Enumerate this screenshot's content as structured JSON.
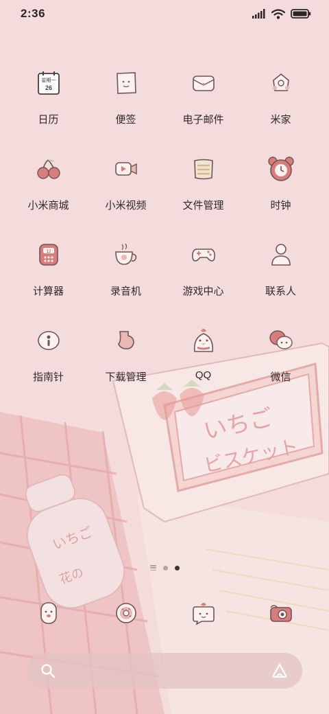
{
  "status_bar": {
    "time": "2:36"
  },
  "home_grid": [
    {
      "label": "日历",
      "icon": "calendar-icon",
      "calendar_weekday": "星期一",
      "calendar_day": "26"
    },
    {
      "label": "便签",
      "icon": "notes-icon"
    },
    {
      "label": "电子邮件",
      "icon": "email-icon"
    },
    {
      "label": "米家",
      "icon": "mijia-icon"
    },
    {
      "label": "小米商城",
      "icon": "cherry-icon"
    },
    {
      "label": "小米视频",
      "icon": "video-camera-icon"
    },
    {
      "label": "文件管理",
      "icon": "folder-icon"
    },
    {
      "label": "时钟",
      "icon": "bear-clock-icon"
    },
    {
      "label": "计算器",
      "icon": "calculator-icon",
      "calculator_display": "12"
    },
    {
      "label": "录音机",
      "icon": "teacup-icon"
    },
    {
      "label": "游戏中心",
      "icon": "gamepad-icon"
    },
    {
      "label": "联系人",
      "icon": "person-icon"
    },
    {
      "label": "指南针",
      "icon": "compass-icon"
    },
    {
      "label": "下载管理",
      "icon": "download-icon"
    },
    {
      "label": "QQ",
      "icon": "duck-icon"
    },
    {
      "label": "微信",
      "icon": "chat-bubbles-icon"
    }
  ],
  "page_indicator": {
    "pages": 2,
    "active": 2
  },
  "dock": [
    {
      "icon": "phone-icon"
    },
    {
      "icon": "donut-icon"
    },
    {
      "icon": "message-icon"
    },
    {
      "icon": "camera-icon"
    }
  ],
  "search": {
    "placeholder": ""
  },
  "wallpaper": {
    "biscuit_text_line1": "いちご",
    "biscuit_text_line2": "ビスケット",
    "bottle_text_line1": "いちご",
    "bottle_text_line2": "花の"
  },
  "colors": {
    "background": "#f4dcdc",
    "accent": "#d97c7c",
    "outline": "#6e5454"
  }
}
